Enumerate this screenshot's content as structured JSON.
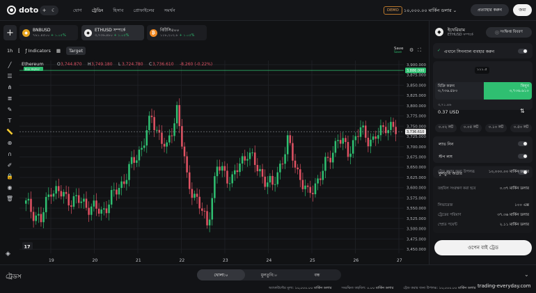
{
  "header": {
    "logo": "doto",
    "nav": [
      "যোগ",
      "ট্রেডিং",
      "হিসাব",
      "প্রোফাইলের",
      "সমর্থন"
    ],
    "demo_badge": "DEMO",
    "balance": "১০,০০০.০০ মার্কিন ডলার",
    "deposit_label": "প্রত্যাহার করুন",
    "login_label": "জমা"
  },
  "assets": [
    {
      "name": "BNBUSD",
      "price": "৭৯১.৪৫০০",
      "change": "+ ১.০৫%",
      "color": "#e7a521",
      "glyph": "◆"
    },
    {
      "name": "ETHUSD সম্পর্কে",
      "price": "৩,৭৩৬.৪৮০",
      "change": "+ ১.০৫%",
      "color": "#5b5f66",
      "glyph": "◆"
    },
    {
      "name": "বিটিসি৫০০",
      "price": "১১৮,২০২.৮",
      "change": "+ ১.০৫%",
      "color": "#f08a24",
      "glyph": "₿"
    }
  ],
  "chart_toolbar": {
    "interval": "1h",
    "indicators": "Indicators",
    "target": "Target",
    "save": "Save",
    "save_sub": "Save"
  },
  "chart_data": {
    "type": "candlestick",
    "symbol": "Ethereum",
    "ohlc_readout": {
      "o": "3,744.870",
      "h": "3,749.180",
      "l": "3,724.780",
      "c": "3,736.610",
      "change": "-8.260 (-0.22%)"
    },
    "tag": "Buy Higher",
    "x_ticks": [
      "19",
      "20",
      "21",
      "22",
      "23",
      "24",
      "25",
      "26",
      "27"
    ],
    "y_ticks": [
      "3,900.000",
      "3,875.000",
      "3,850.000",
      "3,825.000",
      "3,800.000",
      "3,775.000",
      "3,750.000",
      "3,725.000",
      "3,700.000",
      "3,675.000",
      "3,650.000",
      "3,625.000",
      "3,600.000",
      "3,575.000",
      "3,550.000",
      "3,525.000",
      "3,500.000",
      "3,475.000",
      "3,450.000"
    ],
    "ylim": [
      3440,
      3910
    ],
    "target_price": "3,886.000",
    "target_value": 3886,
    "last_price": "3,736.610",
    "last_value": 3736.61,
    "up_color": "#2fbf71",
    "down_color": "#e05263",
    "anchors": [
      [
        0,
        3560
      ],
      [
        6,
        3520
      ],
      [
        10,
        3600
      ],
      [
        16,
        3575
      ],
      [
        22,
        3565
      ],
      [
        30,
        3540
      ],
      [
        38,
        3610
      ],
      [
        46,
        3700
      ],
      [
        50,
        3770
      ],
      [
        56,
        3690
      ],
      [
        60,
        3795
      ],
      [
        64,
        3620
      ],
      [
        68,
        3570
      ],
      [
        72,
        3510
      ],
      [
        76,
        3650
      ],
      [
        82,
        3620
      ],
      [
        88,
        3690
      ],
      [
        92,
        3645
      ],
      [
        98,
        3600
      ],
      [
        104,
        3710
      ],
      [
        108,
        3640
      ],
      [
        112,
        3580
      ],
      [
        118,
        3640
      ],
      [
        124,
        3720
      ],
      [
        128,
        3690
      ],
      [
        133,
        3740
      ],
      [
        138,
        3712
      ],
      [
        143,
        3755
      ],
      [
        147,
        3736
      ]
    ]
  },
  "panel": {
    "title": "ইথেরিয়াম",
    "subtitle": "ETHUSD সম্পর্কে",
    "details_label": "সংক্ষিপ্ত বিবরণ",
    "signal_label": "এখানে সিগন্যাল ব্যবহার করুন",
    "sell_label": "বিক্রি করুন",
    "sell_price": "৩,৭৩৬.৪৮০",
    "buy_label": "কিনুন",
    "buy_price": "৩,৭৩৬.৬১০",
    "spread": "১১১.৫",
    "amount_caption": "৩,৭১.৪৬",
    "amount_value": "0.37 USD",
    "lots": [
      "০.০২ লট",
      "০.০৫ লট",
      "০.১০ লট",
      "০.৫০ লট"
    ],
    "take_profit": "লাভ নিন",
    "stop_loss": "স্টপ লস",
    "pending_order": "মুলতুবি অর্ডার",
    "info": [
      {
        "label": "ট্রেড করার জন্য উপলব্ধ",
        "value": "১০,০০০.০০ মার্কিন ডলার"
      },
      {
        "label": "তহবিল সংরক্ষণ করা হবে",
        "value": "০.৩৭ মার্কিন ডলার"
      },
      {
        "label": "লিভারেজ",
        "value": "১০০ এক্স"
      },
      {
        "label": "ট্রেডের পরিমাণ",
        "value": "৩৭.৩৬ মার্কিন ডলার"
      },
      {
        "label": "স্প্রেড পয়েন্ট",
        "value": "২.১১ মার্কিন ডলার"
      }
    ],
    "open_button": "ওপেন বাই ট্রেড"
  },
  "bottom": {
    "title": "ট্রেডস",
    "tabs": [
      "খোলা:০",
      "মুলতুবি:০",
      "বন্ধ"
    ],
    "status": [
      {
        "label": "অ্যাকাউন্টের মূল্য:",
        "value": "১০,০০০.০০ মার্কিন ডলার"
      },
      {
        "label": "সংরক্ষিত তহবিল:",
        "value": "০.০০ মার্কিন ডলার"
      },
      {
        "label": "ট্রেড করার জন্য উপলব্ধ:",
        "value": "১০,০০০.০০ মার্কিন ডলার"
      }
    ],
    "watermark": "trading-everyday.com"
  }
}
